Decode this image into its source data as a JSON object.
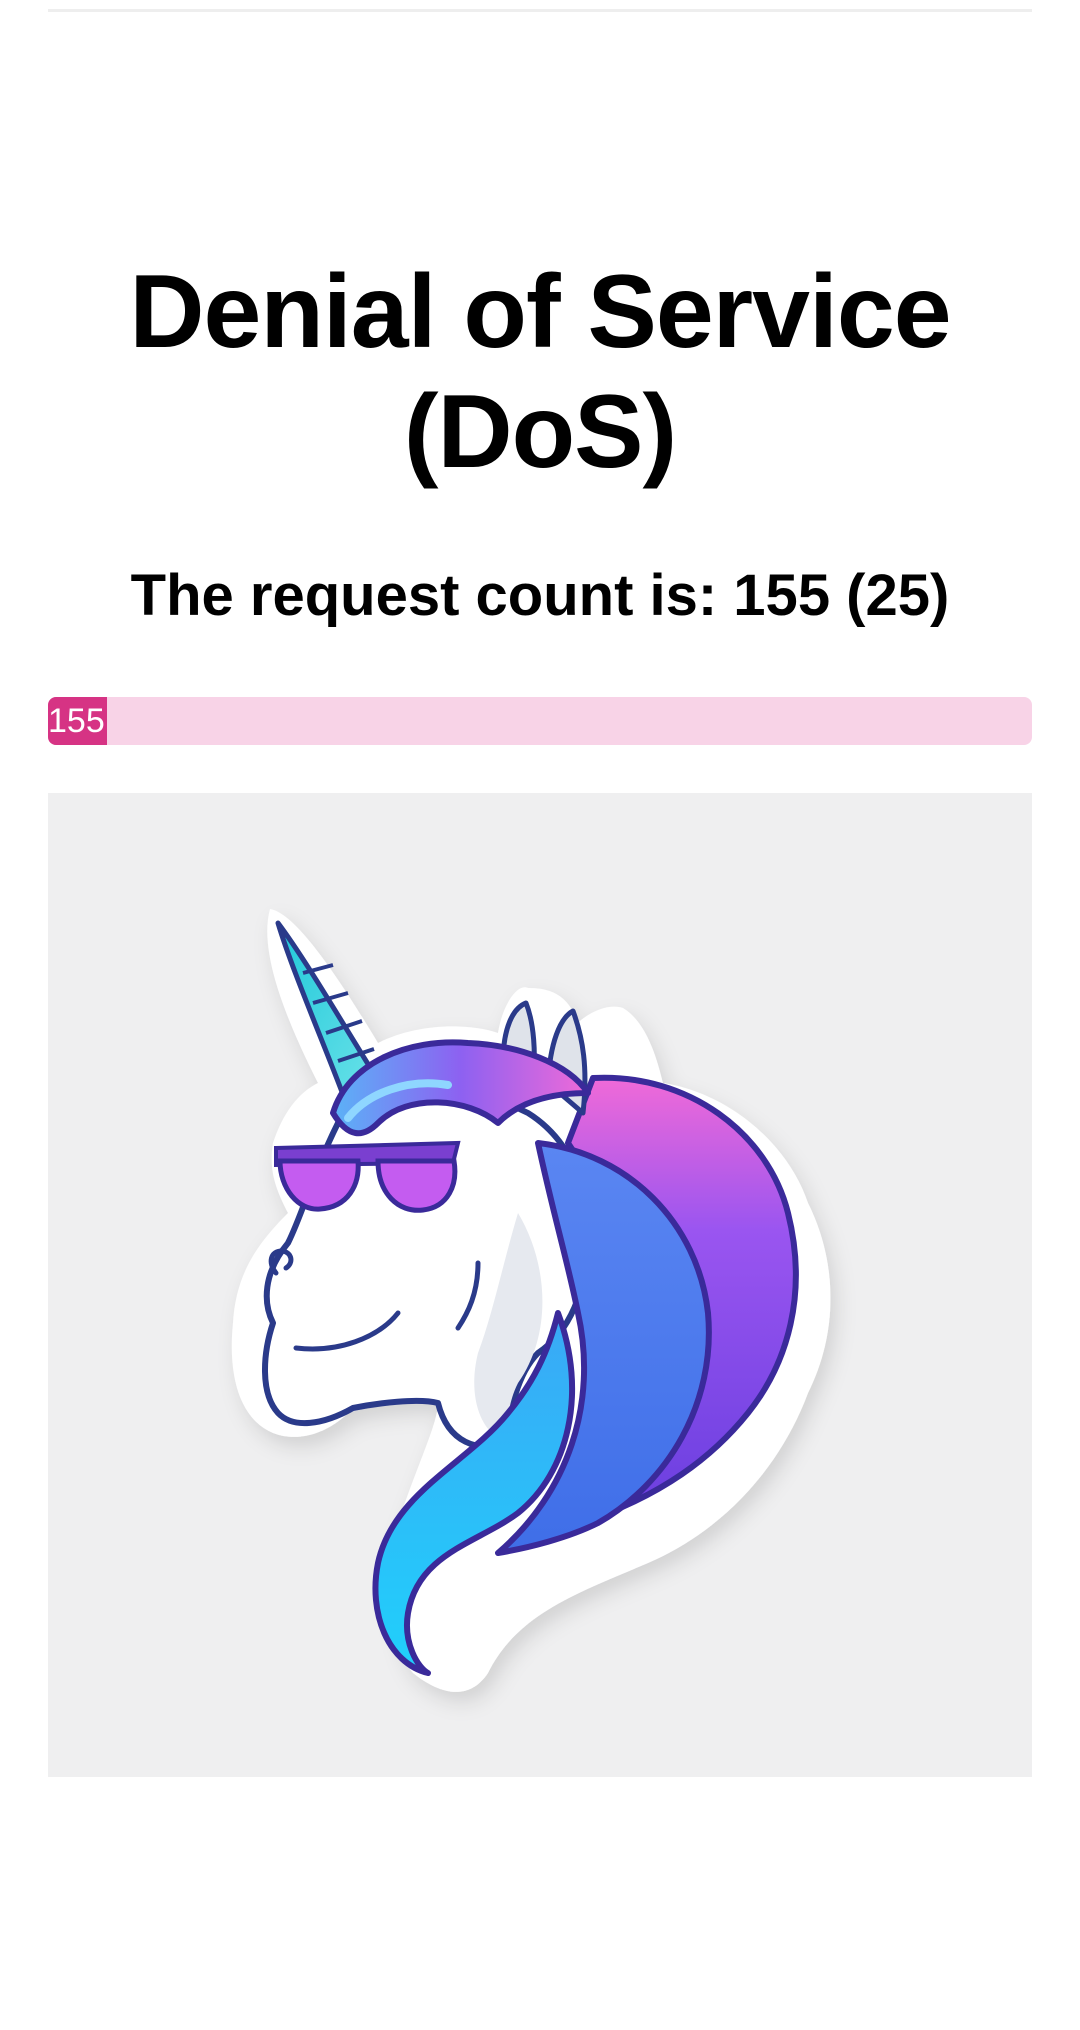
{
  "page": {
    "title": "Denial of Service (DoS)",
    "count_label": "The request count is: 155 (25)"
  },
  "progress": {
    "value": 155,
    "label": "155",
    "fraction": 0.06
  },
  "colors": {
    "progress_fill": "#d63384",
    "progress_track": "#f8d3e7",
    "image_background": "#efeff0"
  },
  "illustration": {
    "subject": "unicorn-with-sunglasses-icon"
  }
}
